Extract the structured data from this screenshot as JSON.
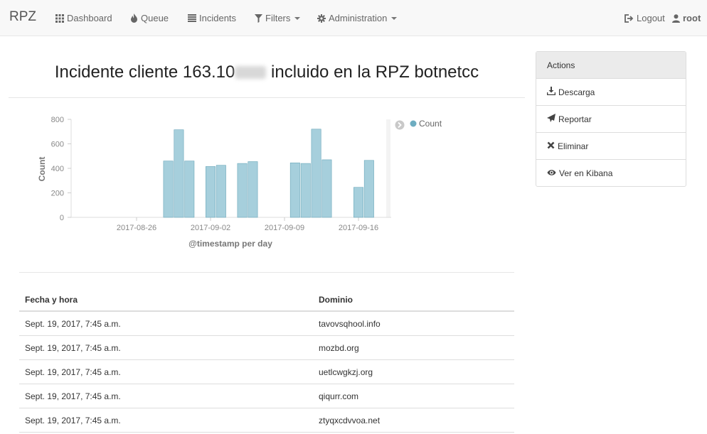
{
  "navbar": {
    "brand": "RPZ",
    "items": [
      {
        "label": "Dashboard",
        "icon": "grid-icon"
      },
      {
        "label": "Queue",
        "icon": "fire-icon"
      },
      {
        "label": "Incidents",
        "icon": "list-icon"
      },
      {
        "label": "Filters",
        "icon": "filter-icon"
      },
      {
        "label": "Administration",
        "icon": "cog-icon"
      }
    ],
    "logout": "Logout",
    "user": "root"
  },
  "page": {
    "title_prefix": "Incidente cliente 163.10",
    "title_suffix": "incluido en la RPZ botnetcc"
  },
  "chart_data": {
    "type": "bar",
    "xlabel": "@timestamp per day",
    "ylabel": "Count",
    "ylim": [
      0,
      800
    ],
    "yticks": [
      "0",
      "200",
      "400",
      "600",
      "800"
    ],
    "x_tick_labels": [
      "2017-08-26",
      "2017-09-02",
      "2017-09-09",
      "2017-09-16"
    ],
    "legend": "Count",
    "series_color": "#a6cfdc",
    "legend_color": "#6eadc1",
    "bars": [
      {
        "date": "2017-08-29",
        "value": 460
      },
      {
        "date": "2017-08-30",
        "value": 715
      },
      {
        "date": "2017-08-31",
        "value": 460
      },
      {
        "date": "2017-09-02",
        "value": 415
      },
      {
        "date": "2017-09-03",
        "value": 425
      },
      {
        "date": "2017-09-05",
        "value": 440
      },
      {
        "date": "2017-09-06",
        "value": 455
      },
      {
        "date": "2017-09-10",
        "value": 445
      },
      {
        "date": "2017-09-11",
        "value": 440
      },
      {
        "date": "2017-09-12",
        "value": 720
      },
      {
        "date": "2017-09-13",
        "value": 470
      },
      {
        "date": "2017-09-16",
        "value": 245
      },
      {
        "date": "2017-09-17",
        "value": 465
      }
    ]
  },
  "table": {
    "headers": [
      "Fecha y hora",
      "Dominio"
    ],
    "rows": [
      [
        "Sept. 19, 2017, 7:45 a.m.",
        "tavovsqhool.info"
      ],
      [
        "Sept. 19, 2017, 7:45 a.m.",
        "mozbd.org"
      ],
      [
        "Sept. 19, 2017, 7:45 a.m.",
        "uetlcwgkzj.org"
      ],
      [
        "Sept. 19, 2017, 7:45 a.m.",
        "qiqurr.com"
      ],
      [
        "Sept. 19, 2017, 7:45 a.m.",
        "ztyqxcdvvoa.net"
      ]
    ]
  },
  "actions": {
    "title": "Actions",
    "items": [
      {
        "label": "Descarga",
        "icon": "download-icon"
      },
      {
        "label": "Reportar",
        "icon": "send-icon"
      },
      {
        "label": "Eliminar",
        "icon": "remove-icon"
      },
      {
        "label": "Ver en Kibana",
        "icon": "eye-icon"
      }
    ]
  }
}
